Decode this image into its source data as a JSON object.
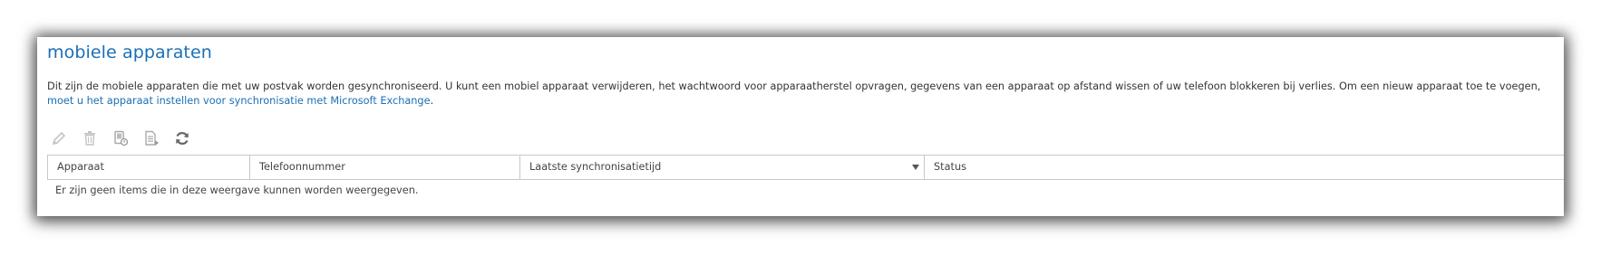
{
  "page": {
    "title": "mobiele apparaten",
    "description_text": "Dit zijn de mobiele apparaten die met uw postvak worden gesynchroniseerd. U kunt een mobiel apparaat verwijderen, het wachtwoord voor apparaatherstel opvragen, gegevens van een apparaat op afstand wissen of uw telefoon blokkeren bij verlies. Om een nieuw apparaat toe te voegen, ",
    "description_link": "moet u het apparaat instellen voor synchronisatie met Microsoft Exchange",
    "description_end": "."
  },
  "toolbar": {
    "icons": [
      "edit-icon",
      "delete-icon",
      "device-recovery-icon",
      "details-icon",
      "refresh-icon"
    ]
  },
  "table": {
    "columns": [
      "Apparaat",
      "Telefoonnummer",
      "Laatste synchronisatietijd",
      "Status"
    ],
    "sorted_column": "Laatste synchronisatietijd",
    "sort_direction": "descending",
    "empty_message": "Er zijn geen items die in deze weergave kunnen worden weergegeven."
  },
  "colors": {
    "accent": "#1a6fb5",
    "text": "#333333",
    "icon_disabled": "#c4c4c4",
    "icon_enabled": "#666666"
  }
}
